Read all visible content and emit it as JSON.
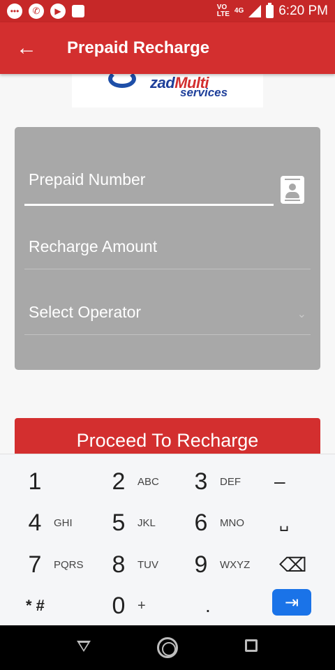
{
  "status_bar": {
    "time": "6:20 PM",
    "network": "4G",
    "volte_top": "VO",
    "volte_bottom": "LTE"
  },
  "app_bar": {
    "title": "Prepaid Recharge",
    "back_icon": "arrow-left-icon"
  },
  "logo": {
    "brand_main": "zad",
    "brand_accent": "Multi",
    "brand_sub": "services"
  },
  "form": {
    "prepaid_number": {
      "placeholder": "Prepaid Number",
      "value": ""
    },
    "recharge_amount": {
      "placeholder": "Recharge Amount",
      "value": ""
    },
    "operator": {
      "placeholder": "Select Operator",
      "value": ""
    }
  },
  "proceed_button": {
    "label": "Proceed To Recharge"
  },
  "keypad": {
    "keys": [
      {
        "digit": "1",
        "letters": ""
      },
      {
        "digit": "2",
        "letters": "ABC"
      },
      {
        "digit": "3",
        "letters": "DEF"
      },
      {
        "digit": "–",
        "letters": ""
      },
      {
        "digit": "4",
        "letters": "GHI"
      },
      {
        "digit": "5",
        "letters": "JKL"
      },
      {
        "digit": "6",
        "letters": "MNO"
      },
      {
        "digit": "␣",
        "letters": ""
      },
      {
        "digit": "7",
        "letters": "PQRS"
      },
      {
        "digit": "8",
        "letters": "TUV"
      },
      {
        "digit": "9",
        "letters": "WXYZ"
      },
      {
        "digit": "⌫",
        "letters": ""
      },
      {
        "digit": "* #",
        "letters": ""
      },
      {
        "digit": "0",
        "letters": "+"
      },
      {
        "digit": ".",
        "letters": ""
      },
      {
        "digit": "⇥",
        "letters": ""
      }
    ]
  },
  "colors": {
    "primary": "#d32f2f",
    "card": "#a8a8a8",
    "enter_key": "#1a73e8"
  }
}
